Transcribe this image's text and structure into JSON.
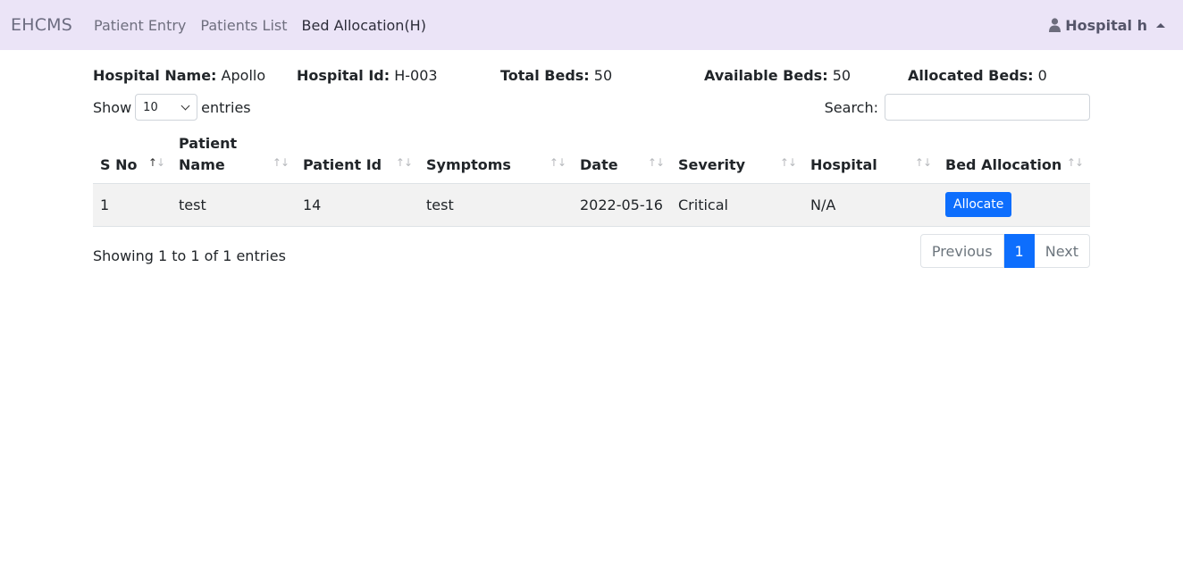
{
  "navbar": {
    "brand": "EHCMS",
    "links": [
      "Patient Entry",
      "Patients List",
      "Bed Allocation(H)"
    ],
    "user": "Hospital h"
  },
  "info": {
    "hospital_name_label": "Hospital Name:",
    "hospital_name": "Apollo",
    "hospital_id_label": "Hospital Id:",
    "hospital_id": "H-003",
    "total_beds_label": "Total Beds:",
    "total_beds": "50",
    "available_beds_label": "Available Beds:",
    "available_beds": "50",
    "allocated_beds_label": "Allocated Beds:",
    "allocated_beds": "0"
  },
  "controls": {
    "show_label": "Show",
    "entries_value": "10",
    "entries_label": "entries",
    "search_label": "Search:"
  },
  "table": {
    "headers": [
      "S No",
      "Patient Name",
      "Patient Id",
      "Symptoms",
      "Date",
      "Severity",
      "Hospital",
      "Bed Allocation"
    ],
    "rows": [
      {
        "sno": "1",
        "name": "test",
        "id": "14",
        "symptoms": "test",
        "date": "2022-05-16",
        "severity": "Critical",
        "hospital": "N/A",
        "action": "Allocate"
      }
    ]
  },
  "footer": {
    "info": "Showing 1 to 1 of 1 entries",
    "previous": "Previous",
    "page": "1",
    "next": "Next"
  }
}
